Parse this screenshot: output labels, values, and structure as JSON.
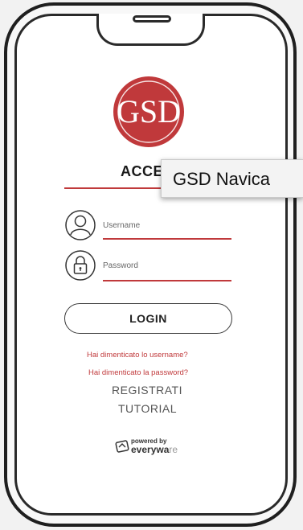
{
  "app": {
    "title": "ACCE",
    "tooltip": "GSD Navica"
  },
  "logo": {
    "text": "GSD"
  },
  "form": {
    "username_label": "Username",
    "password_label": "Password",
    "login_label": "LOGIN"
  },
  "links": {
    "forgot_username": "Hai dimenticato lo username?",
    "forgot_password": "Hai dimenticato la password?",
    "register": "REGISTRATI",
    "tutorial": "TUTORIAL"
  },
  "footer": {
    "powered_by": "powered by",
    "brand_main": "everywa",
    "brand_suffix": "re"
  },
  "colors": {
    "accent": "#c0393b",
    "phone_frame": "#2a2a2a"
  }
}
